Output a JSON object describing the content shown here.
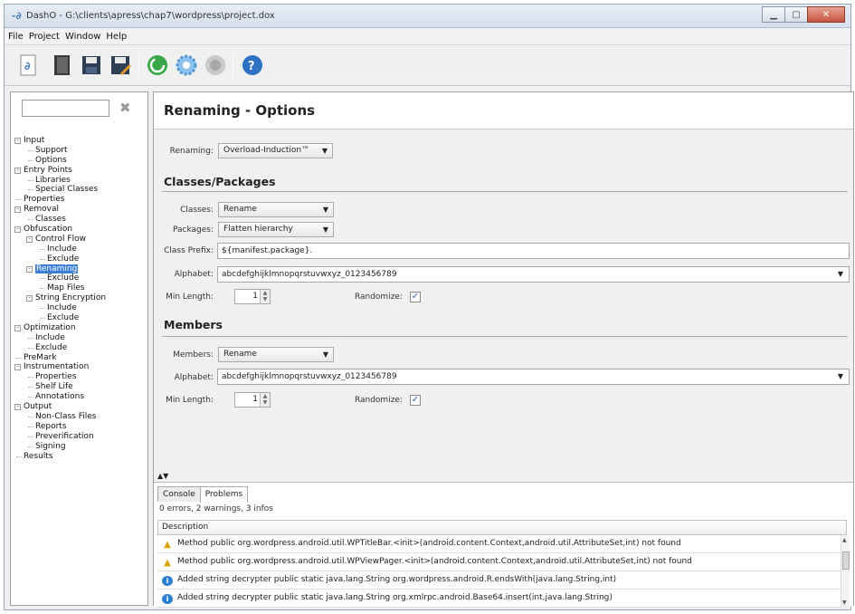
{
  "window": {
    "title": "DashO - G:\\clients\\apress\\chap7\\wordpress\\project.dox"
  },
  "menu": [
    "File",
    "Project",
    "Window",
    "Help"
  ],
  "toolbar_icons": [
    "new-project-icon",
    "open-project-icon",
    "save-icon",
    "save-as-icon",
    "build-icon",
    "settings-gear-icon",
    "stop-icon",
    "help-icon"
  ],
  "tree": [
    {
      "label": "Input",
      "level": 0,
      "expander": "-"
    },
    {
      "label": "Support",
      "level": 1
    },
    {
      "label": "Options",
      "level": 1
    },
    {
      "label": "Entry Points",
      "level": 0,
      "expander": "-"
    },
    {
      "label": "Libraries",
      "level": 1
    },
    {
      "label": "Special Classes",
      "level": 1
    },
    {
      "label": "Properties",
      "level": 0
    },
    {
      "label": "Removal",
      "level": 0,
      "expander": "-"
    },
    {
      "label": "Classes",
      "level": 1
    },
    {
      "label": "Obfuscation",
      "level": 0,
      "expander": "-"
    },
    {
      "label": "Control Flow",
      "level": 1,
      "expander": "-"
    },
    {
      "label": "Include",
      "level": 2
    },
    {
      "label": "Exclude",
      "level": 2
    },
    {
      "label": "Renaming",
      "level": 1,
      "expander": "-",
      "selected": true
    },
    {
      "label": "Exclude",
      "level": 2
    },
    {
      "label": "Map Files",
      "level": 2
    },
    {
      "label": "String Encryption",
      "level": 1,
      "expander": "-"
    },
    {
      "label": "Include",
      "level": 2
    },
    {
      "label": "Exclude",
      "level": 2
    },
    {
      "label": "Optimization",
      "level": 0,
      "expander": "-"
    },
    {
      "label": "Include",
      "level": 1
    },
    {
      "label": "Exclude",
      "level": 1
    },
    {
      "label": "PreMark",
      "level": 0
    },
    {
      "label": "Instrumentation",
      "level": 0,
      "expander": "-"
    },
    {
      "label": "Properties",
      "level": 1
    },
    {
      "label": "Shelf Life",
      "level": 1
    },
    {
      "label": "Annotations",
      "level": 1
    },
    {
      "label": "Output",
      "level": 0,
      "expander": "-"
    },
    {
      "label": "Non-Class Files",
      "level": 1
    },
    {
      "label": "Reports",
      "level": 1
    },
    {
      "label": "Preverification",
      "level": 1
    },
    {
      "label": "Signing",
      "level": 1
    },
    {
      "label": "Results",
      "level": 0
    }
  ],
  "page": {
    "title": "Renaming - Options",
    "renaming_label": "Renaming:",
    "renaming_value": "Overload-Induction™",
    "classes_section": "Classes/Packages",
    "classes_label": "Classes:",
    "classes_value": "Rename",
    "packages_label": "Packages:",
    "packages_value": "Flatten hierarchy",
    "prefix_label": "Class Prefix:",
    "prefix_value": "${manifest.package}.",
    "alphabet_label": "Alphabet:",
    "alphabet_value": "abcdefghijklmnopqrstuvwxyz_0123456789",
    "minlen_label": "Min Length:",
    "minlen_value": "1",
    "randomize_label": "Randomize:",
    "members_section": "Members",
    "members_label": "Members:",
    "members_value": "Rename",
    "m_alphabet_label": "Alphabet:",
    "m_alphabet_value": "abcdefghijklmnopqrstuvwxyz_0123456789",
    "m_minlen_label": "Min Length:",
    "m_minlen_value": "1",
    "m_randomize_label": "Randomize:"
  },
  "bottom": {
    "tabs": [
      "Console",
      "Problems"
    ],
    "summary": "0 errors, 2 warnings, 3 infos",
    "column": "Description",
    "issues": [
      {
        "type": "warning",
        "text": "Method public org.wordpress.android.util.WPTitleBar.<init>(android.content.Context,android.util.AttributeSet,int) not found"
      },
      {
        "type": "warning",
        "text": "Method public org.wordpress.android.util.WPViewPager.<init>(android.content.Context,android.util.AttributeSet,int) not found"
      },
      {
        "type": "info",
        "text": "Added string decrypter public static java.lang.String org.wordpress.android.R.endsWith(java.lang.String,int)"
      },
      {
        "type": "info",
        "text": "Added string decrypter public static java.lang.String org.xmlrpc.android.Base64.insert(int,java.lang.String)"
      }
    ]
  }
}
